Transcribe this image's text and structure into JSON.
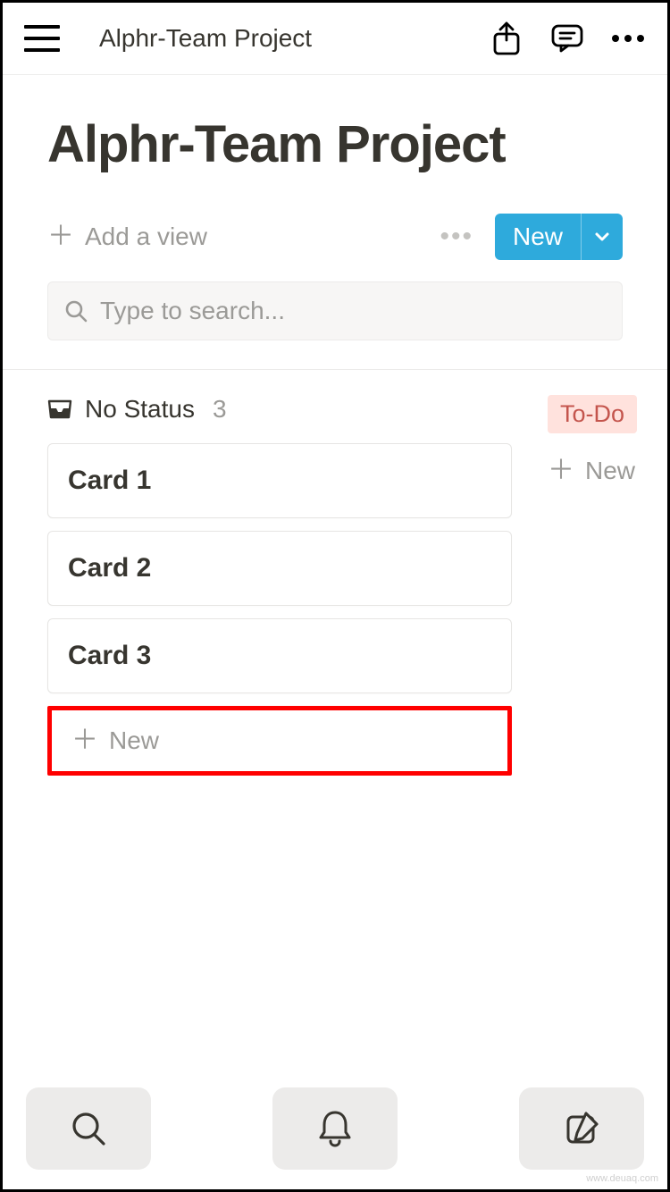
{
  "header": {
    "breadcrumb_title": "Alphr-Team Project"
  },
  "page": {
    "title": "Alphr-Team Project",
    "add_view_label": "Add a view",
    "new_button_label": "New",
    "search_placeholder": "Type to search..."
  },
  "board": {
    "columns": [
      {
        "name": "No Status",
        "count": "3",
        "cards": [
          "Card 1",
          "Card 2",
          "Card 3"
        ],
        "new_label": "New"
      },
      {
        "name": "To-Do",
        "tag_style": "todo",
        "cards": [],
        "new_label": "New"
      }
    ]
  },
  "colors": {
    "accent": "#2eaadc",
    "todo_bg": "#ffe2dd",
    "todo_fg": "#c4554d"
  }
}
